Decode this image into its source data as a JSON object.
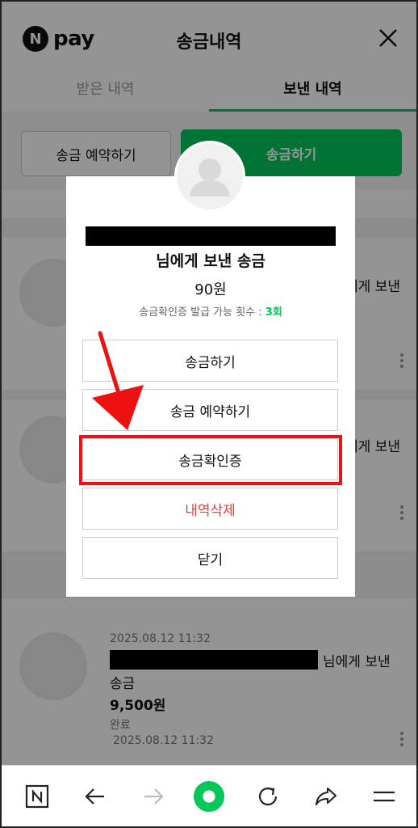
{
  "header": {
    "logo_letter": "N",
    "logo_text": "pay",
    "title": "송금내역"
  },
  "tabs": [
    {
      "label": "받은 내역",
      "active": false
    },
    {
      "label": "보낸 내역",
      "active": true
    }
  ],
  "actions": {
    "reserve_label": "송금 예약하기",
    "send_label": "송금하기"
  },
  "background_list": {
    "row1_tail": "에게 보낸",
    "row2_tail": "에게 보낸",
    "item": {
      "date": "2025.08.12 11:32",
      "name_tail": "님에게 보낸",
      "name_line2": "송금",
      "amount": "9,500원",
      "status": "완료",
      "date2": "2025.08.12 11:32"
    }
  },
  "modal": {
    "title": "님에게 보낸 송금",
    "amount": "90원",
    "sub_label": "송금확인증 발급 가능 횟수 : ",
    "sub_count": "3회",
    "buttons": {
      "send": "송금하기",
      "reserve": "송금 예약하기",
      "certificate": "송금확인증",
      "delete": "내역삭제",
      "close": "닫기"
    }
  },
  "colors": {
    "accent": "#03c75a",
    "danger": "#e0443a",
    "highlight": "#e11111"
  }
}
